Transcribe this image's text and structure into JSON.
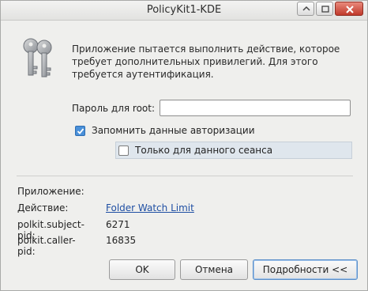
{
  "window": {
    "title": "PolicyKit1-KDE"
  },
  "message": "Приложение пытается выполнить действие, которое требует дополнительных привилегий. Для этого требуется аутентификация.",
  "password": {
    "label": "Пароль для root:",
    "value": ""
  },
  "remember": {
    "label": "Запомнить данные авторизации",
    "checked": true
  },
  "session_only": {
    "label": "Только для данного сеанса",
    "checked": false
  },
  "details": {
    "application_label": "Приложение:",
    "application_value": "",
    "action_label": "Действие:",
    "action_value": "Folder Watch Limit",
    "subject_pid_label": "polkit.subject-pid:",
    "subject_pid_value": "6271",
    "caller_pid_label": "polkit.caller-pid:",
    "caller_pid_value": "16835"
  },
  "buttons": {
    "ok": "OK",
    "cancel": "Отмена",
    "details": "Подробности <<"
  },
  "colors": {
    "accent": "#4a90d9",
    "link": "#1f4fa3",
    "close": "#c0392b"
  }
}
